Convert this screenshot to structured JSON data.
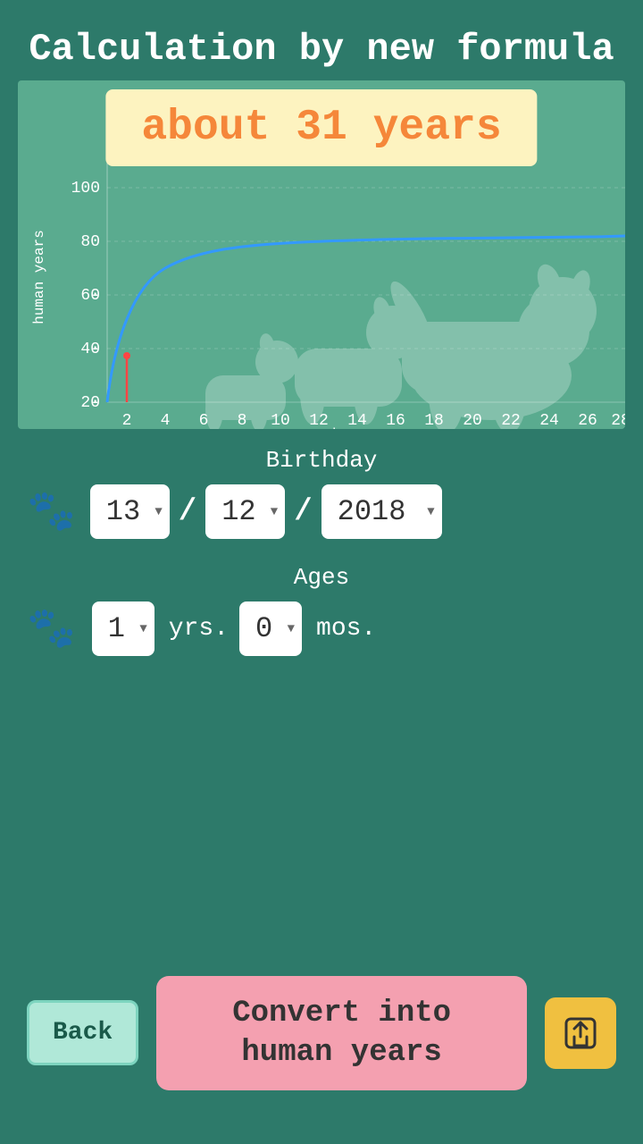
{
  "title": "Calculation by new formula",
  "result": {
    "label": "about 31 years"
  },
  "chart": {
    "x_label": "dog years",
    "y_label": "human years",
    "x_ticks": [
      "2",
      "4",
      "6",
      "8",
      "10",
      "12",
      "14",
      "16",
      "18",
      "20",
      "22",
      "24",
      "26",
      "28"
    ],
    "y_ticks": [
      "20",
      "40",
      "60",
      "80",
      "100"
    ],
    "accent_color": "#3399ff"
  },
  "birthday": {
    "label": "Birthday",
    "day_value": "13",
    "month_value": "12",
    "year_value": "2018"
  },
  "ages": {
    "label": "Ages",
    "years_value": "1",
    "months_value": "0",
    "years_unit": "yrs.",
    "months_unit": "mos."
  },
  "buttons": {
    "back_label": "Back",
    "convert_label": "Convert into\nhuman years",
    "share_icon": "share"
  }
}
